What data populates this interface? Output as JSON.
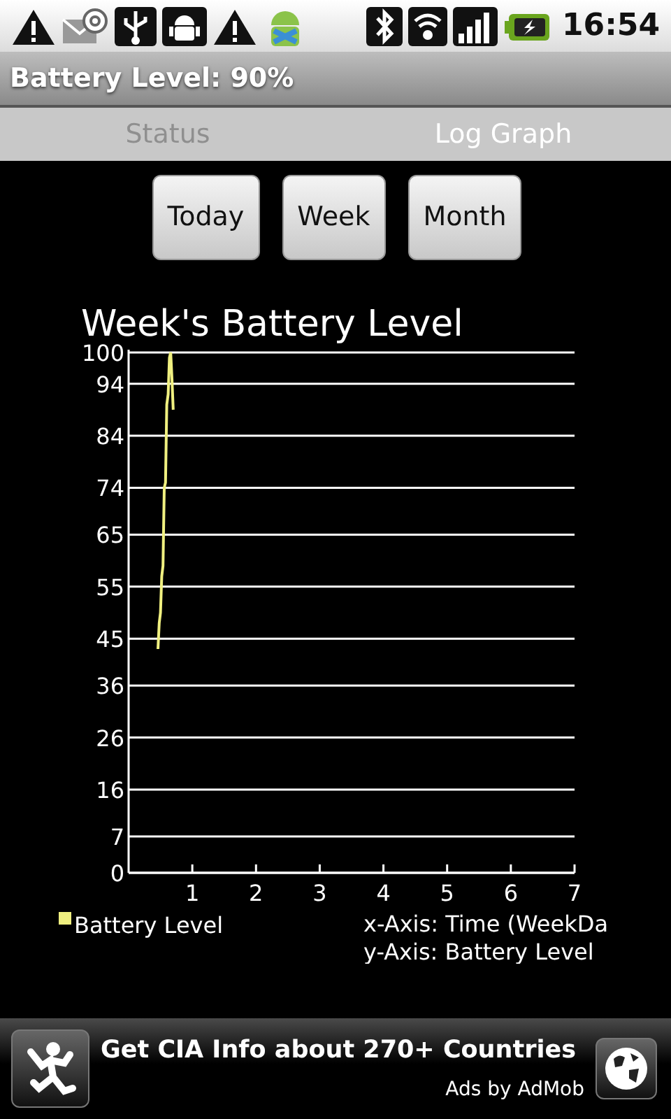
{
  "status_bar": {
    "time": "16:54"
  },
  "title": "Battery Level: 90%",
  "tabs": [
    {
      "label": "Status",
      "selected": false
    },
    {
      "label": "Log Graph",
      "selected": true
    }
  ],
  "range_buttons": [
    "Today",
    "Week",
    "Month"
  ],
  "chart": {
    "chart_data": {
      "type": "line",
      "grid": true,
      "title": "Week's Battery Level",
      "x": [
        0.46,
        0.48,
        0.5,
        0.52,
        0.54,
        0.56,
        0.58,
        0.6,
        0.62,
        0.64,
        0.66,
        0.68,
        0.7
      ],
      "series": [
        {
          "name": "Battery Level",
          "color": "#f0f080",
          "values": [
            43,
            48,
            50,
            57,
            59,
            74,
            75,
            90,
            92,
            99,
            100,
            95,
            89
          ]
        }
      ],
      "xlim": [
        0,
        7
      ],
      "ylim": [
        0,
        100
      ],
      "xticks": [
        1,
        2,
        3,
        4,
        5,
        6,
        7
      ],
      "yticks": [
        0,
        7,
        16,
        26,
        36,
        45,
        55,
        65,
        74,
        84,
        94,
        100
      ]
    },
    "axis_notes": [
      "x-Axis: Time (WeekDa",
      "y-Axis: Battery Level"
    ]
  },
  "ad": {
    "headline": "Get CIA Info about 270+ Countries",
    "attribution": "Ads by AdMob"
  }
}
